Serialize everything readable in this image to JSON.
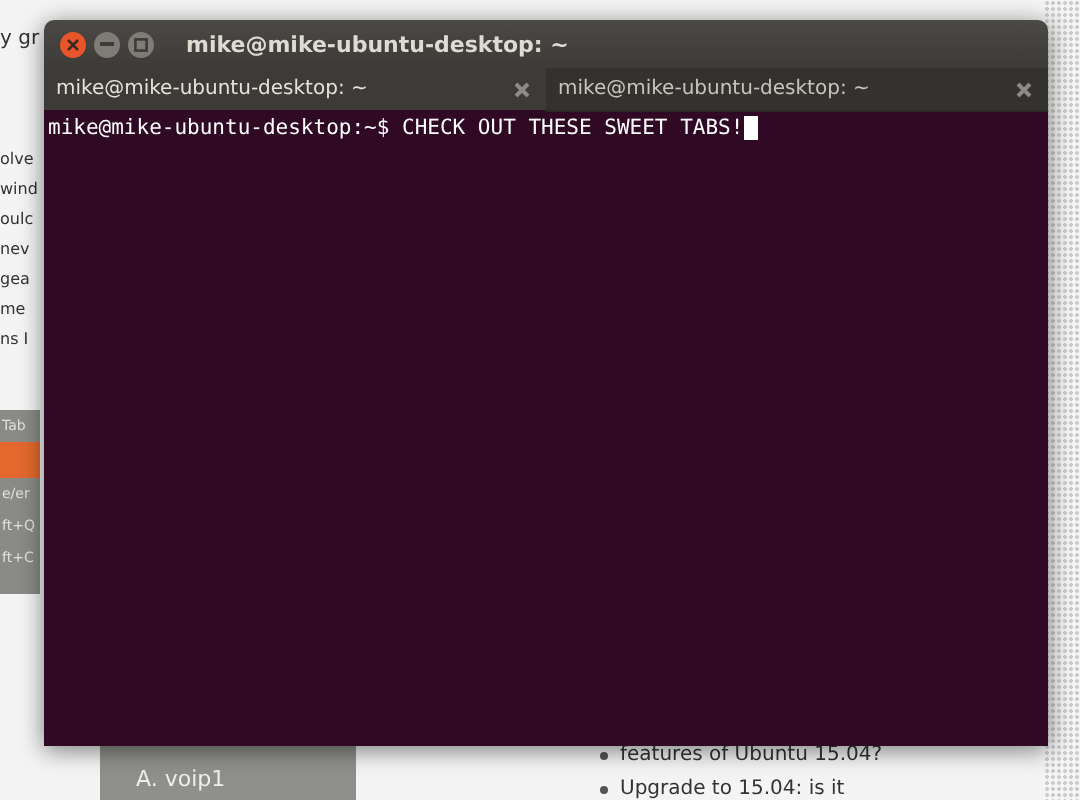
{
  "background_page": {
    "heading_fragment": "y gr",
    "text_fragments": [
      {
        "text": "olve"
      },
      {
        "text": "wind"
      },
      {
        "text": "oulc"
      },
      {
        "text": "nev"
      },
      {
        "text": "gea"
      },
      {
        "text": "me"
      },
      {
        "text": "ns I"
      }
    ],
    "menu_fragments": [
      {
        "text": "Tab",
        "selected": false
      },
      {
        "selected": true
      },
      {
        "text": "e/er",
        "selected": false
      },
      {
        "text": "ft+Q",
        "selected": false
      },
      {
        "text": "ft+C",
        "selected": false
      }
    ],
    "list_item": "A. voip1",
    "links": [
      "features of Ubuntu 15.04?",
      "Upgrade to 15.04: is it"
    ]
  },
  "terminal": {
    "title": "mike@mike-ubuntu-desktop: ~",
    "tabs": [
      {
        "label": "mike@mike-ubuntu-desktop: ~",
        "selected": true
      },
      {
        "label": "mike@mike-ubuntu-desktop: ~",
        "selected": false
      }
    ],
    "lines": [
      "mike@mike-ubuntu-desktop:~$ CHECK OUT THESE SWEET TABS!"
    ],
    "cursor": true
  }
}
